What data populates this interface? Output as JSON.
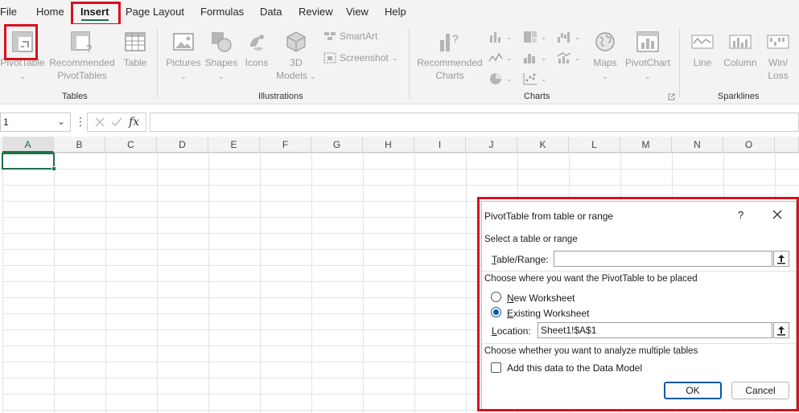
{
  "menu": {
    "tabs": [
      {
        "label": "File"
      },
      {
        "label": "Home"
      },
      {
        "label": "Insert"
      },
      {
        "label": "Page Layout"
      },
      {
        "label": "Formulas"
      },
      {
        "label": "Data"
      },
      {
        "label": "Review"
      },
      {
        "label": "View"
      },
      {
        "label": "Help"
      }
    ],
    "active_tab": "Insert"
  },
  "ribbon": {
    "tables": {
      "group_label": "Tables",
      "pivottable": "PivotTable",
      "recommended_line1": "Recommended",
      "recommended_line2": "PivotTables",
      "table": "Table"
    },
    "illustrations": {
      "group_label": "Illustrations",
      "pictures": "Pictures",
      "shapes": "Shapes",
      "icons": "Icons",
      "models_line1": "3D",
      "models_line2": "Models",
      "smartart": "SmartArt",
      "screenshot": "Screenshot"
    },
    "charts": {
      "group_label": "Charts",
      "recommended_line1": "Recommended",
      "recommended_line2": "Charts",
      "maps": "Maps",
      "pivotchart": "PivotChart"
    },
    "sparklines": {
      "group_label": "Sparklines",
      "line": "Line",
      "column": "Column",
      "winloss_line1": "Win/",
      "winloss_line2": "Loss"
    }
  },
  "formula_bar": {
    "name_box": "1",
    "fx": "fx",
    "formula": ""
  },
  "grid": {
    "columns": [
      "A",
      "B",
      "C",
      "D",
      "E",
      "F",
      "G",
      "H",
      "I",
      "J",
      "K",
      "L",
      "M",
      "N",
      "O"
    ],
    "selected_column": "A"
  },
  "dialog": {
    "title": "PivotTable from table or range",
    "help": "?",
    "section_select": "Select a table or range",
    "table_range_label_u": "T",
    "table_range_label_rest": "able/Range:",
    "table_range_value": "",
    "section_place": "Choose where you want the PivotTable to be placed",
    "new_ws_u": "N",
    "new_ws_rest": "ew Worksheet",
    "existing_ws_u": "E",
    "existing_ws_rest": "xisting Worksheet",
    "placement_selected": "Existing Worksheet",
    "location_label_u": "L",
    "location_label_rest": "ocation:",
    "location_value": "Sheet1!$A$1",
    "section_multiple": "Choose whether you want to analyze multiple tables",
    "data_model_label": "Add this data to the Data Model",
    "data_model_checked": false,
    "ok": "OK",
    "cancel": "Cancel"
  },
  "colors": {
    "accent_green": "#1e7145",
    "highlight_red": "#d8121e",
    "dialog_blue": "#0a59a5"
  }
}
